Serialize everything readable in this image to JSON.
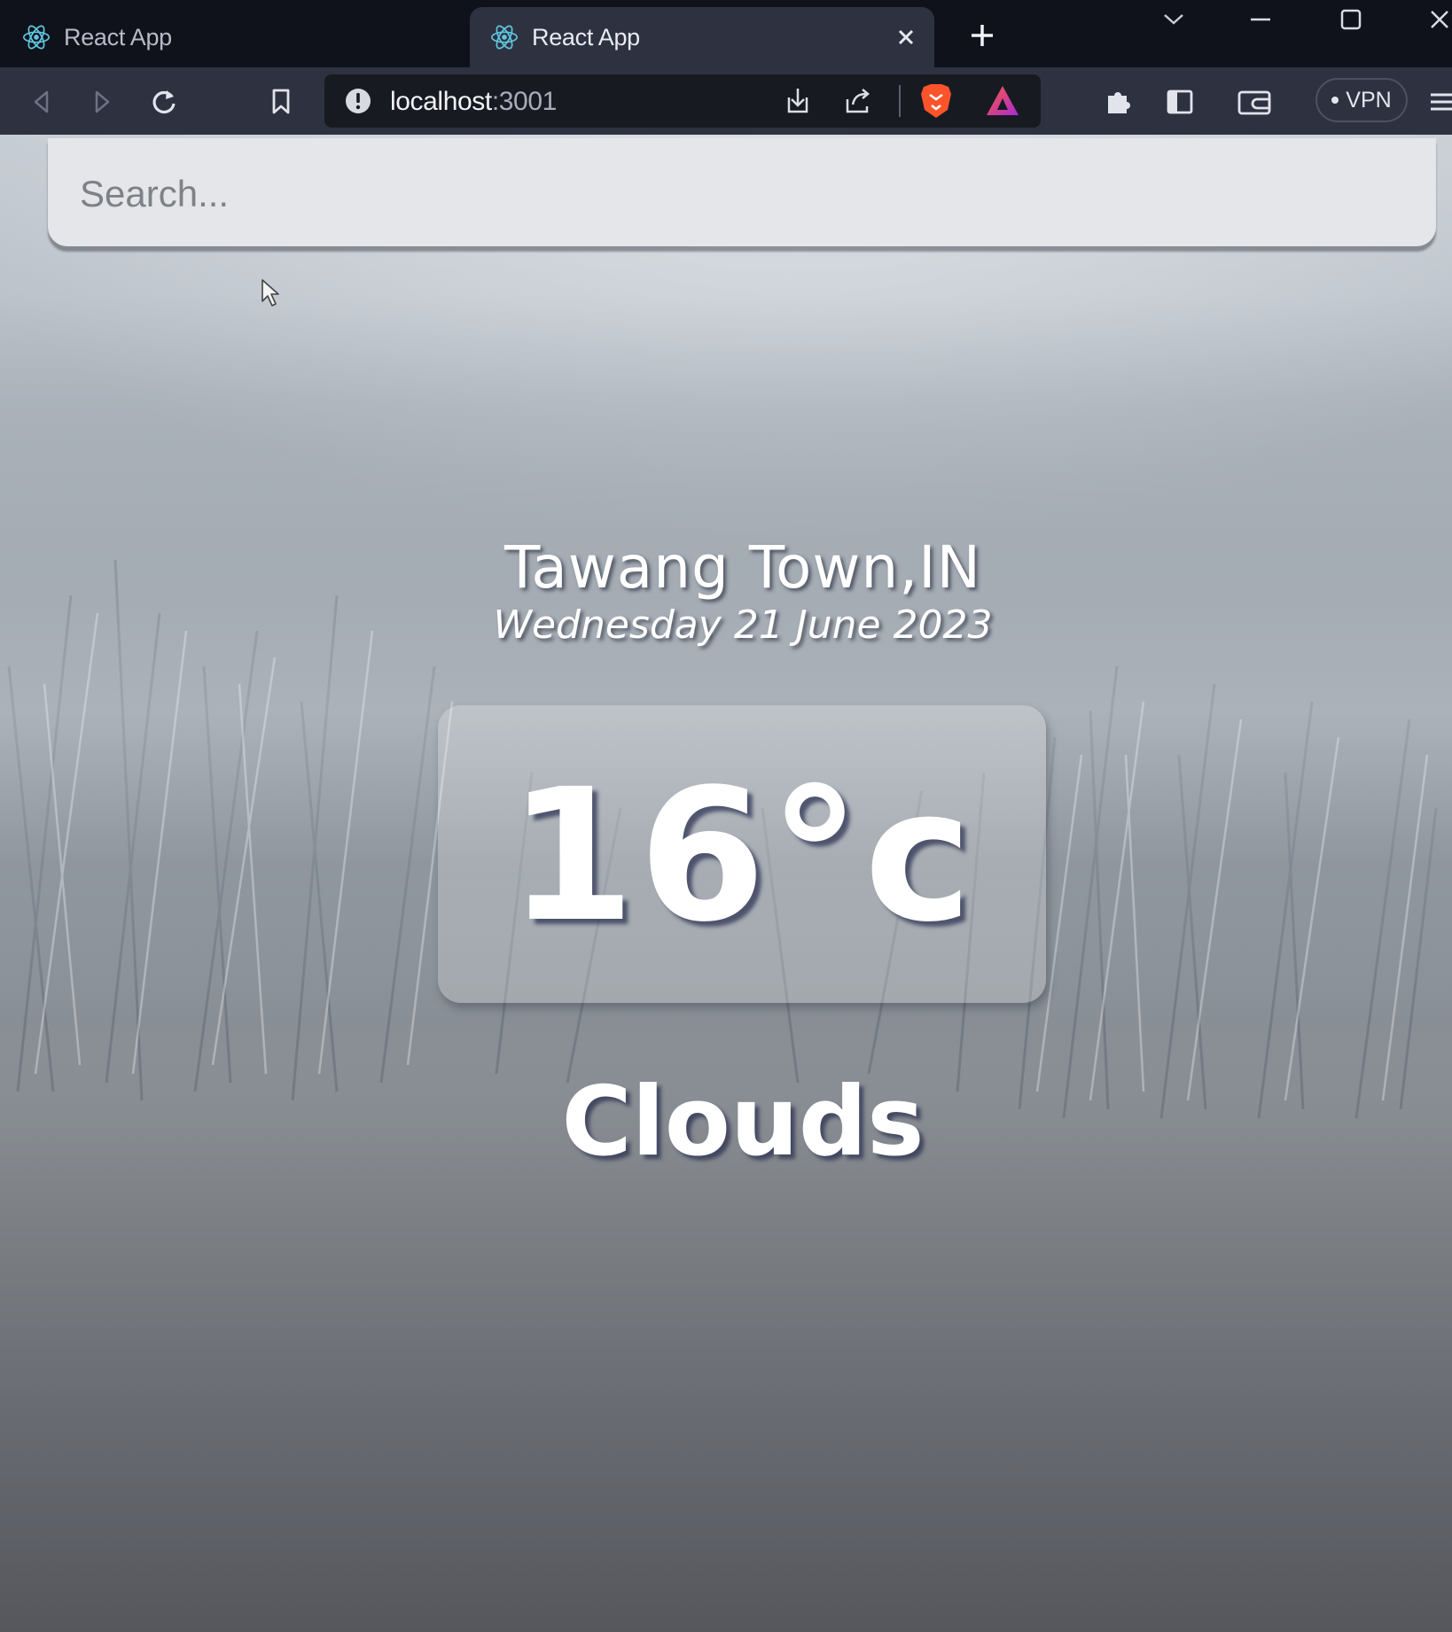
{
  "browser": {
    "tabs": [
      {
        "title": "React App",
        "active": false
      },
      {
        "title": "React App",
        "active": true
      }
    ],
    "address": {
      "host": "localhost",
      "port": ":3001"
    },
    "vpn_label": "VPN"
  },
  "app": {
    "search": {
      "placeholder": "Search...",
      "value": ""
    },
    "location": "Tawang Town,IN",
    "date": "Wednesday 21 June 2023",
    "temperature": "16°c",
    "weather": "Clouds"
  },
  "icons": {
    "tab_favicon": "react-icon",
    "tab_close": "close-icon",
    "new_tab": "plus-icon",
    "tab_list": "chevron-down-icon",
    "minimize": "minimize-icon",
    "maximize": "maximize-icon",
    "close_window": "close-icon",
    "back": "back-icon",
    "forward": "forward-icon",
    "reload": "reload-icon",
    "bookmark": "bookmark-icon",
    "site_info": "info-icon",
    "install": "download-icon",
    "share": "share-icon",
    "brave_shields": "brave-lion-icon",
    "brave_rewards": "rewards-triangle-icon",
    "extensions": "puzzle-icon",
    "sidebar": "sidebar-icon",
    "wallet": "wallet-icon",
    "menu": "hamburger-icon"
  },
  "colors": {
    "tabstrip": "#10121b",
    "toolbar": "#2e3140",
    "omnibox": "#181a22",
    "brave_orange": "#fb542b",
    "rewards_purple": "#a82ad6",
    "text_white": "#ffffff"
  }
}
